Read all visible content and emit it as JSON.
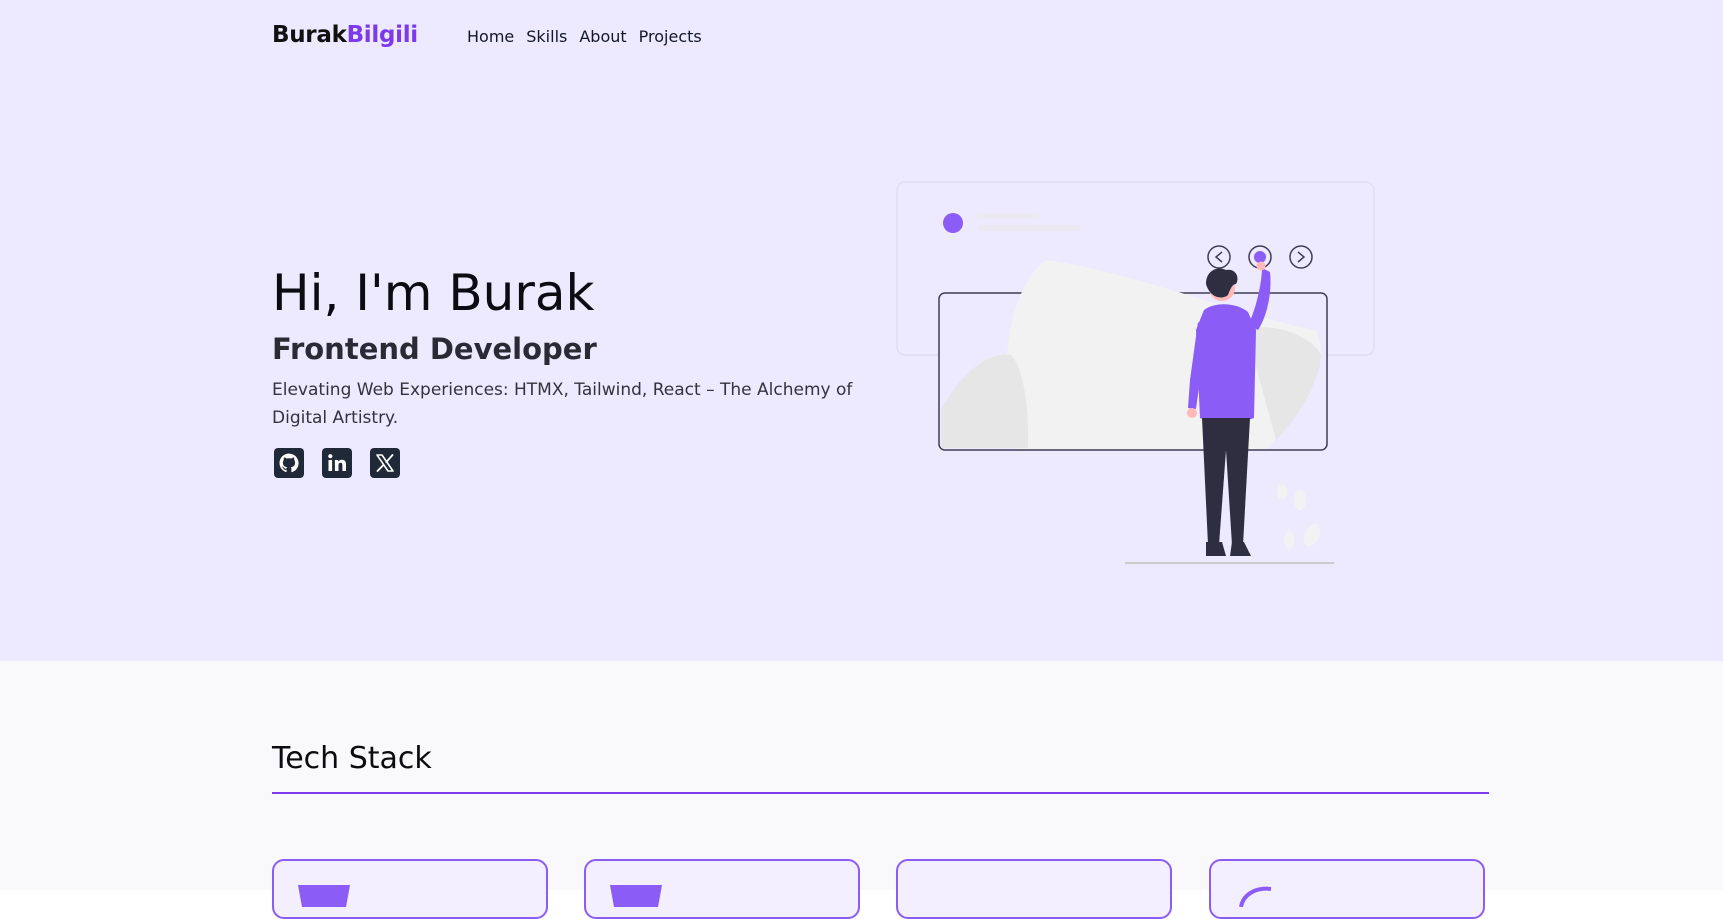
{
  "header": {
    "logo_first": "Burak",
    "logo_last": "Bilgili",
    "nav": [
      "Home",
      "Skills",
      "About",
      "Projects"
    ]
  },
  "hero": {
    "greeting": "Hi, I'm Burak",
    "role": "Frontend Developer",
    "tagline": "Elevating Web Experiences: HTMX, Tailwind, React – The Alchemy of Digital Artistry.",
    "socials": [
      "github-icon",
      "linkedin-icon",
      "x-icon"
    ]
  },
  "tech": {
    "title": "Tech Stack",
    "cards": [
      "html5-icon",
      "css3-icon",
      "tailwind-icon",
      "react-icon"
    ]
  },
  "colors": {
    "accent": "#7c3aed",
    "hero_bg": "#ede9fe",
    "section_bg": "#f9f9fb"
  }
}
